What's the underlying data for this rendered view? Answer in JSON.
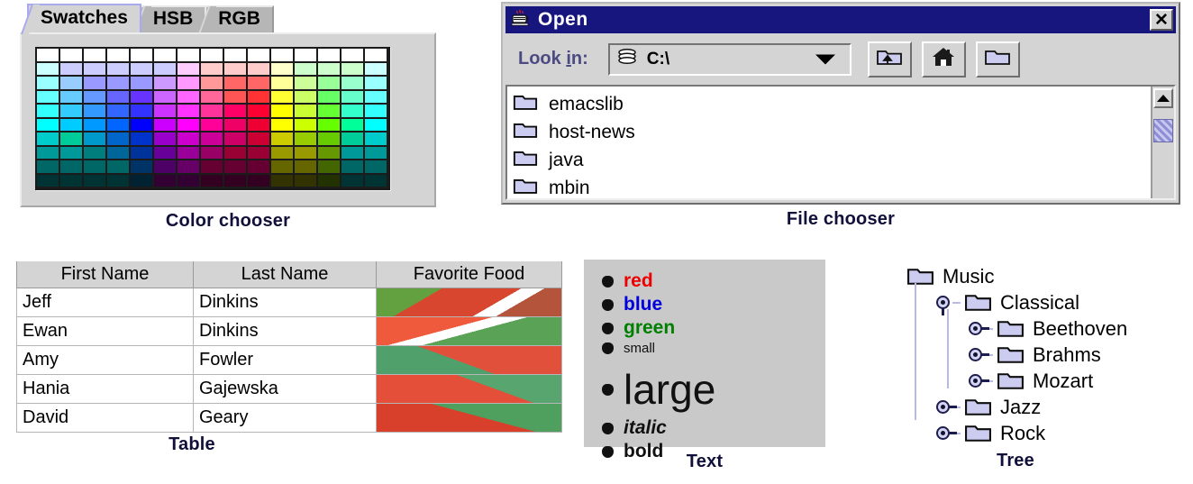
{
  "color_chooser": {
    "caption": "Color chooser",
    "tabs": [
      {
        "label": "Swatches",
        "selected": true
      },
      {
        "label": "HSB",
        "selected": false
      },
      {
        "label": "RGB",
        "selected": false
      }
    ],
    "swatches": {
      "rows": 10,
      "cols": 15,
      "grid": [
        [
          "#ffffff",
          "#ffffff",
          "#ffffff",
          "#ffffff",
          "#ffffff",
          "#ffffff",
          "#ffffff",
          "#ffffff",
          "#ffffff",
          "#ffffff",
          "#ffffff",
          "#ffffff",
          "#ffffff",
          "#ffffff",
          "#ffffff"
        ],
        [
          "#ccffff",
          "#ccccff",
          "#ccccff",
          "#ccccff",
          "#ccccff",
          "#ccccff",
          "#ffccff",
          "#ffcccc",
          "#ffcccc",
          "#ffcccc",
          "#ffffcc",
          "#ccffcc",
          "#ccffcc",
          "#ccffcc",
          "#ccffff"
        ],
        [
          "#99ffff",
          "#99ccff",
          "#9999ff",
          "#9999ff",
          "#9999ff",
          "#cc99ff",
          "#ff99ff",
          "#ff9999",
          "#ff6666",
          "#ff6666",
          "#ffff99",
          "#ccff99",
          "#99ff99",
          "#99ffcc",
          "#99ffff"
        ],
        [
          "#66ffff",
          "#66ccff",
          "#6699ff",
          "#6666ff",
          "#6633ff",
          "#cc66ff",
          "#ff66ff",
          "#ff6699",
          "#ff5555",
          "#ff3333",
          "#ffff33",
          "#ccff66",
          "#66ff66",
          "#66ffcc",
          "#66ffff"
        ],
        [
          "#33ffff",
          "#33ccff",
          "#3399ff",
          "#3366ff",
          "#3333ff",
          "#cc33ff",
          "#ff33ff",
          "#ff3399",
          "#ff0066",
          "#ff0033",
          "#ffff00",
          "#ccff33",
          "#66ff33",
          "#33ffcc",
          "#33ffff"
        ],
        [
          "#00ffff",
          "#00ccff",
          "#0099ff",
          "#0066ff",
          "#0000ff",
          "#cc00ff",
          "#ff00ff",
          "#ff0099",
          "#ee0066",
          "#ee0033",
          "#ffff00",
          "#ccff00",
          "#66ff00",
          "#00ff99",
          "#00ffff"
        ],
        [
          "#00cccc",
          "#00cc99",
          "#0099cc",
          "#0066cc",
          "#0033cc",
          "#9900cc",
          "#cc00cc",
          "#cc0099",
          "#cc0066",
          "#cc0033",
          "#cccc00",
          "#99cc00",
          "#66cc00",
          "#00cc99",
          "#00cccc"
        ],
        [
          "#009999",
          "#009999",
          "#007d7d",
          "#006699",
          "#003399",
          "#660099",
          "#990099",
          "#990066",
          "#990033",
          "#990033",
          "#999900",
          "#999900",
          "#669900",
          "#009999",
          "#009999"
        ],
        [
          "#006666",
          "#006666",
          "#006666",
          "#006666",
          "#003366",
          "#4d0066",
          "#660066",
          "#660033",
          "#660033",
          "#660033",
          "#666600",
          "#666600",
          "#446600",
          "#006666",
          "#006666"
        ],
        [
          "#003333",
          "#003333",
          "#003333",
          "#003333",
          "#002233",
          "#330033",
          "#330033",
          "#330022",
          "#330022",
          "#330022",
          "#333300",
          "#333300",
          "#223300",
          "#003333",
          "#003333"
        ]
      ]
    }
  },
  "file_chooser": {
    "caption": "File chooser",
    "title": "Open",
    "title_icon": "java-cup-icon",
    "close_label": "✕",
    "lookin_label_pre": "Look ",
    "lookin_label_mnemonic": "i",
    "lookin_label_post": "n:",
    "combo_value": "C:\\",
    "combo_icon": "drive-icon",
    "toolbar_buttons": [
      {
        "name": "up-folder-button",
        "icon": "up-folder-icon"
      },
      {
        "name": "home-button",
        "icon": "home-icon"
      },
      {
        "name": "new-folder-button",
        "icon": "new-folder-icon"
      }
    ],
    "files": [
      {
        "name": "emacslib",
        "icon": "folder-icon"
      },
      {
        "name": "host-news",
        "icon": "folder-icon"
      },
      {
        "name": "java",
        "icon": "folder-icon"
      },
      {
        "name": "mbin",
        "icon": "folder-icon"
      }
    ],
    "scrollbar": {
      "up_icon": "scroll-up-arrow-icon",
      "thumb": "scroll-thumb"
    }
  },
  "table": {
    "caption": "Table",
    "columns": [
      "First Name",
      "Last Name",
      "Favorite Food"
    ],
    "rows": [
      {
        "first": "Jeff",
        "last": "Dinkins",
        "food": "strawberry-image"
      },
      {
        "first": "Ewan",
        "last": "Dinkins",
        "food": "strawberry-image"
      },
      {
        "first": "Amy",
        "last": "Fowler",
        "food": "strawberry-image"
      },
      {
        "first": "Hania",
        "last": "Gajewska",
        "food": "watermelon-image"
      },
      {
        "first": "David",
        "last": "Geary",
        "food": "watermelon-image"
      }
    ]
  },
  "text": {
    "caption": "Text",
    "bg": "#c9c9c9",
    "items": [
      {
        "label": "red",
        "color": "#ee0000",
        "size": 21,
        "weight": "bold",
        "style": "normal"
      },
      {
        "label": "blue",
        "color": "#0000dd",
        "size": 21,
        "weight": "bold",
        "style": "normal"
      },
      {
        "label": "green",
        "color": "#008000",
        "size": 21,
        "weight": "bold",
        "style": "normal"
      },
      {
        "label": "small",
        "color": "#111111",
        "size": 15,
        "weight": "normal",
        "style": "normal"
      },
      {
        "label": "large",
        "color": "#111111",
        "size": 46,
        "weight": "normal",
        "style": "normal"
      },
      {
        "label": "italic",
        "color": "#111111",
        "size": 21,
        "weight": "bold",
        "style": "italic"
      },
      {
        "label": "bold",
        "color": "#111111",
        "size": 21,
        "weight": "bold",
        "style": "normal"
      }
    ]
  },
  "tree": {
    "caption": "Tree",
    "nodes": [
      {
        "label": "Music",
        "depth": 0,
        "handle": "none",
        "icon": "folder-icon"
      },
      {
        "label": "Classical",
        "depth": 1,
        "handle": "expanded",
        "icon": "folder-icon"
      },
      {
        "label": "Beethoven",
        "depth": 2,
        "handle": "collapsed",
        "icon": "folder-icon"
      },
      {
        "label": "Brahms",
        "depth": 2,
        "handle": "collapsed",
        "icon": "folder-icon"
      },
      {
        "label": "Mozart",
        "depth": 2,
        "handle": "collapsed",
        "icon": "folder-icon"
      },
      {
        "label": "Jazz",
        "depth": 1,
        "handle": "collapsed",
        "icon": "folder-icon"
      },
      {
        "label": "Rock",
        "depth": 1,
        "handle": "collapsed",
        "icon": "folder-icon"
      }
    ]
  }
}
